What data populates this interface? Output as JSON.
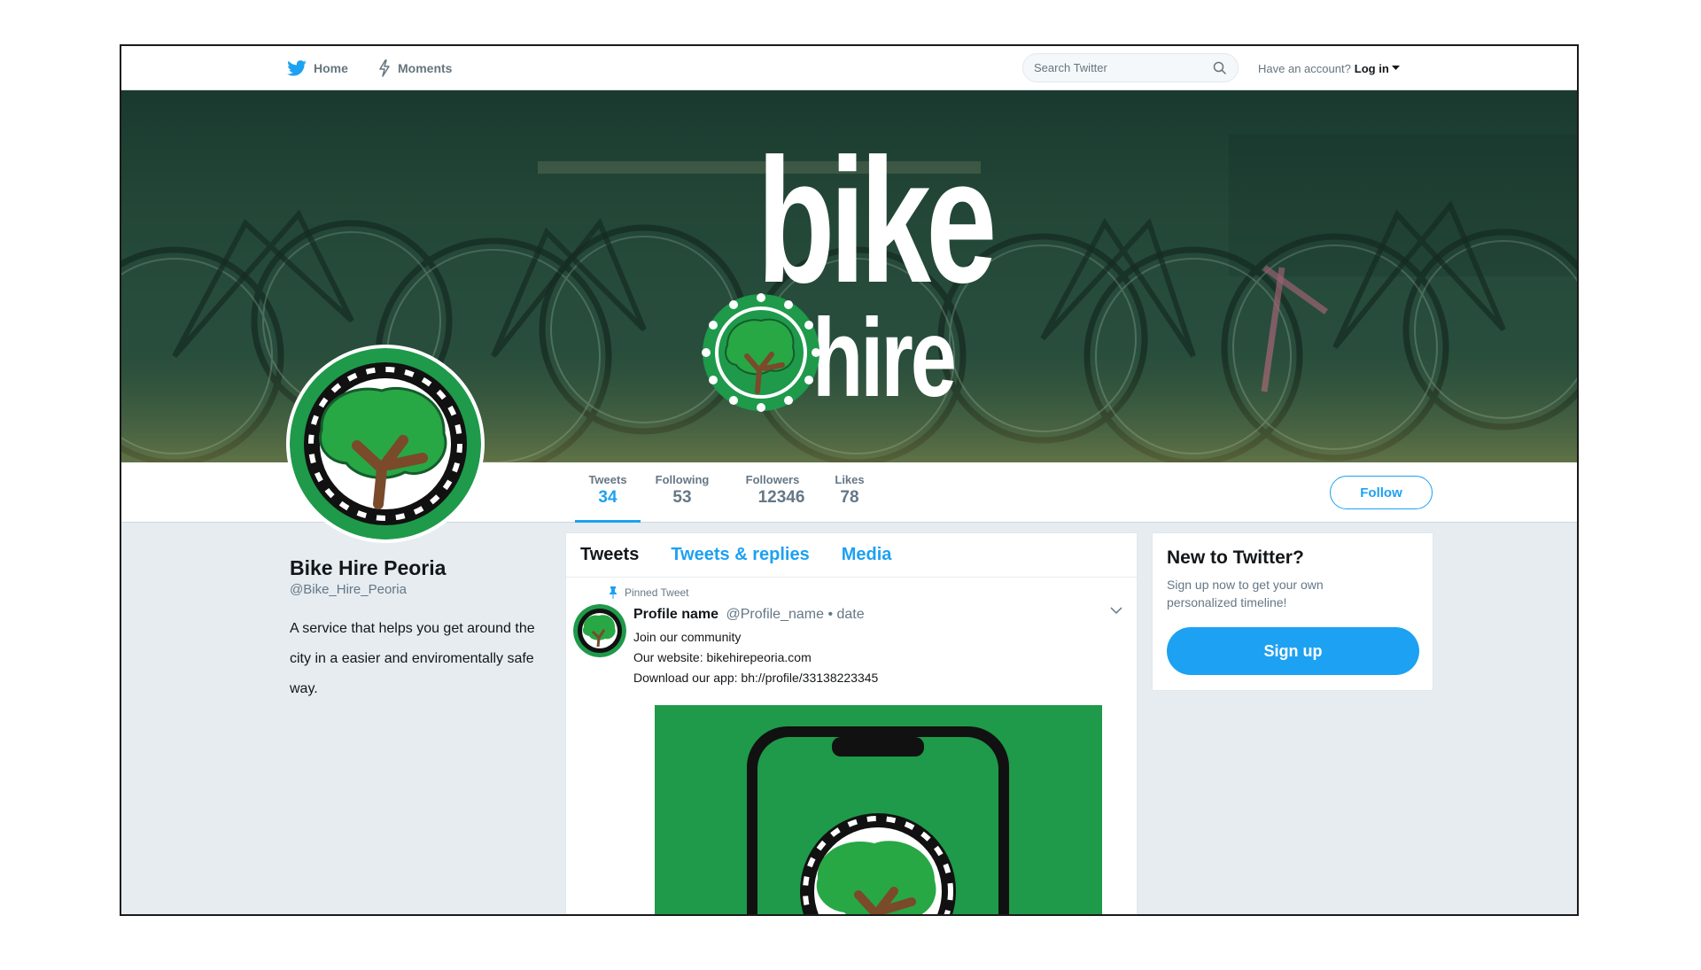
{
  "topnav": {
    "home_label": "Home",
    "moments_label": "Moments",
    "search_placeholder": "Search Twitter",
    "account_prompt": "Have an account?",
    "login_label": "Log in"
  },
  "banner": {
    "title": "bike",
    "subtitle": "hire"
  },
  "profile": {
    "name": "Bike Hire Peoria",
    "handle": "@Bike_Hire_Peoria",
    "bio": "A service that helps you get around the city in a easier and enviromentally safe way."
  },
  "stats": {
    "tweets_label": "Tweets",
    "tweets_value": "34",
    "following_label": "Following",
    "following_value": "53",
    "followers_label": "Followers",
    "followers_value": "12346",
    "likes_label": "Likes",
    "likes_value": "78"
  },
  "follow_label": "Follow",
  "timeline": {
    "tabs": [
      {
        "label": "Tweets"
      },
      {
        "label": "Tweets & replies"
      },
      {
        "label": "Media"
      }
    ],
    "pinned_label": "Pinned Tweet",
    "tweet": {
      "name": "Profile name",
      "handle_date": "@Profile_name • date",
      "lines": [
        "Join our community",
        "Our website: bikehirepeoria.com",
        "Download our app: bh://profile/33138223345"
      ]
    }
  },
  "signup": {
    "title": "New to Twitter?",
    "subtitle": "Sign up now to get your own personalized timeline!",
    "button_label": "Sign up"
  },
  "colors": {
    "twitter_blue": "#1da1f2",
    "brand_green": "#1e9a4a",
    "tree_brown": "#7a4a2a",
    "page_bg": "#e6ecf0"
  }
}
